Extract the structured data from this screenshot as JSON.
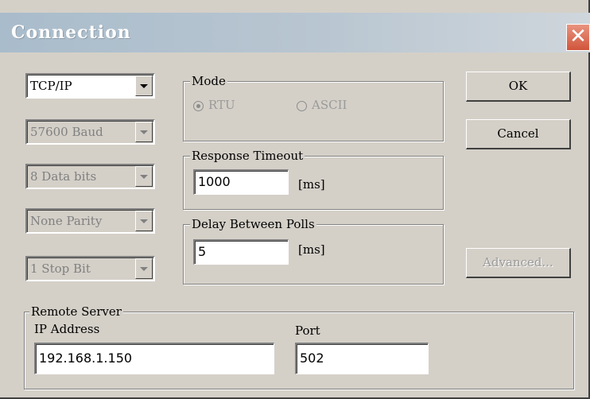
{
  "window": {
    "title": "Connection",
    "close_glyph": "✕"
  },
  "left_settings": {
    "connection_type": "TCP/IP",
    "baud_rate": "57600 Baud",
    "data_bits": "8 Data bits",
    "parity": "None Parity",
    "stop_bits": "1 Stop Bit"
  },
  "mode": {
    "label": "Mode",
    "rtu_label": "RTU",
    "ascii_label": "ASCII",
    "selected": "RTU"
  },
  "response_timeout": {
    "label": "Response Timeout",
    "value": "1000",
    "unit": "[ms]"
  },
  "delay_between_polls": {
    "label": "Delay Between Polls",
    "value": "5",
    "unit": "[ms]"
  },
  "buttons": {
    "ok": "OK",
    "cancel": "Cancel",
    "advanced": "Advanced..."
  },
  "remote_server": {
    "label": "Remote Server",
    "ip_label": "IP Address",
    "ip_value": "192.168.1.150",
    "port_label": "Port",
    "port_value": "502"
  },
  "colors": {
    "dialog_bg": "#d4d0c8",
    "titlebar": "#b9c6d1",
    "close_button": "#d0553b",
    "disabled_text": "#808080"
  }
}
